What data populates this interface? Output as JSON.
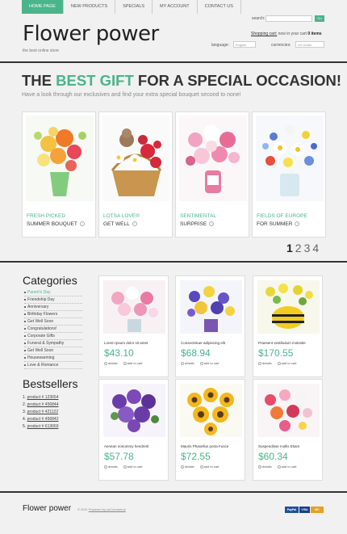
{
  "nav": {
    "items": [
      "HOME PAGE",
      "NEW PRODUCTS",
      "SPECIALS",
      "MY ACCOUNT",
      "CONTACT US"
    ]
  },
  "header": {
    "logo": "Flower power",
    "tagline": "the best online store",
    "search_label": "search:",
    "search_button": "Go",
    "cart_link": "Shopping cart:",
    "cart_text": "now in your cart",
    "cart_items": "0 items",
    "language_label": "language:",
    "language_value": "English",
    "currencies_label": "currencies:",
    "currency_value": "US Dollar"
  },
  "hero": {
    "title_before": "THE ",
    "title_accent": "BEST GIFT",
    "title_after": " FOR A SPECIAL OCCASION!",
    "subtitle": "Have a look through our exclusives and find your extra special bouquet second to none!"
  },
  "featured": [
    {
      "line1": "FRESH PICKED",
      "line2": "SUMMER BOUQUET"
    },
    {
      "line1": "LOTSA LOVE®",
      "line2": "GET WELL"
    },
    {
      "line1": "SENTIMENTAL",
      "line2": "SURPRISE"
    },
    {
      "line1": "FIELDS OF EUROPE",
      "line2": "FOR SUMMER"
    }
  ],
  "pager": [
    "1",
    "2",
    "3",
    "4"
  ],
  "sidebar": {
    "categories_title": "Categories",
    "categories": [
      "Parent's Day",
      "Friendship Day",
      "Anniversary",
      "Birthday Flowers",
      "Get Well Soon",
      "Congratulations!",
      "Corporate Gifts",
      "Funeral & Sympathy",
      "Get Well Soon",
      "Housewarming",
      "Love & Romance"
    ],
    "bestsellers_title": "Bestsellers",
    "bestsellers": [
      {
        "n": "1.",
        "label": "product # 123654"
      },
      {
        "n": "2.",
        "label": "product # 456844"
      },
      {
        "n": "3.",
        "label": "product # 421122"
      },
      {
        "n": "4.",
        "label": "product # 456842"
      },
      {
        "n": "5.",
        "label": "product # 613669"
      }
    ]
  },
  "products": [
    {
      "name": "Lorem ipsum dolor sit amet",
      "price": "$43.10"
    },
    {
      "name": "Consectetuer adipiscing elit",
      "price": "$68.94"
    },
    {
      "name": "Praesent vestibulum molestie",
      "price": "$170.55"
    },
    {
      "name": "Aenean nonummy hendrerit",
      "price": "$57.78"
    },
    {
      "name": "Mauris Phasellus porta Fusce",
      "price": "$72.55"
    },
    {
      "name": "Suspendisse mollis Etiam",
      "price": "$60.34"
    }
  ],
  "product_actions": {
    "details": "details",
    "add_to_cart": "add to cart"
  },
  "footer": {
    "logo": "Flower power",
    "copy": "© 2011",
    "copy_link": "Powered by osCommerce",
    "pay1": "PayPal",
    "pay2": "VISA",
    "pay3": "MC"
  },
  "colors": {
    "accent": "#4ab58a",
    "dark": "#333333"
  }
}
